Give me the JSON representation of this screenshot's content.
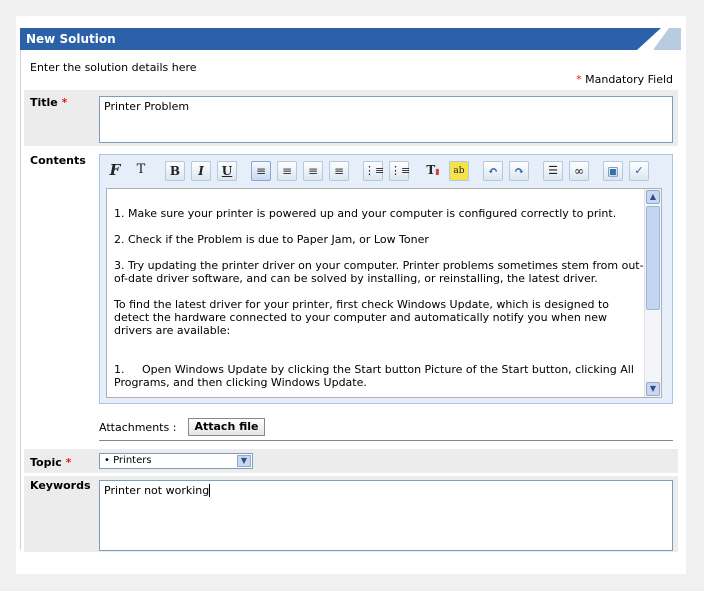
{
  "header": {
    "title": "New Solution"
  },
  "intro": "Enter the solution details here",
  "mandatory": {
    "star": "*",
    "text": "Mandatory Field"
  },
  "title_field": {
    "label": "Title",
    "star": "*",
    "value": "Printer Problem"
  },
  "contents": {
    "label": "Contents",
    "toolbar": [
      {
        "name": "font-family-icon",
        "glyph": "F"
      },
      {
        "name": "font-size-icon",
        "glyph": "T"
      },
      {
        "name": "bold-icon",
        "glyph": "B"
      },
      {
        "name": "italic-icon",
        "glyph": "I"
      },
      {
        "name": "underline-icon",
        "glyph": "U"
      },
      {
        "name": "align-left-icon",
        "glyph": "≡"
      },
      {
        "name": "align-center-icon",
        "glyph": "≡"
      },
      {
        "name": "align-right-icon",
        "glyph": "≡"
      },
      {
        "name": "justify-icon",
        "glyph": "≡"
      },
      {
        "name": "ordered-list-icon",
        "glyph": "⋮"
      },
      {
        "name": "unordered-list-icon",
        "glyph": "⋮"
      },
      {
        "name": "text-color-icon",
        "glyph": "T"
      },
      {
        "name": "highlight-icon",
        "glyph": "ab"
      },
      {
        "name": "undo-icon",
        "glyph": "↶"
      },
      {
        "name": "redo-icon",
        "glyph": "↷"
      },
      {
        "name": "horizontal-rule-icon",
        "glyph": "☰"
      },
      {
        "name": "link-icon",
        "glyph": "∞"
      },
      {
        "name": "insert-image-icon",
        "glyph": "▣"
      },
      {
        "name": "spellcheck-icon",
        "glyph": "✓"
      }
    ],
    "paragraphs": [
      "1. Make sure your printer is powered up and your computer is configured correctly to print.",
      "2. Check if the Problem is due to Paper Jam, or Low Toner",
      "3. Try updating the printer driver on your computer. Printer problems sometimes stem from out-of-date driver software, and can be solved by installing, or reinstalling, the latest driver.",
      "To find the latest driver for your printer, first check Windows Update, which is designed to detect the hardware connected to your computer and automatically notify you when new drivers are available:",
      "1.     Open Windows Update by clicking the Start button Picture of the Start button, clicking All Programs, and then clicking Windows Update."
    ]
  },
  "attachments": {
    "label": "Attachments :",
    "button": "Attach file"
  },
  "topic": {
    "label": "Topic",
    "star": "*",
    "value": "• Printers"
  },
  "keywords": {
    "label": "Keywords",
    "value": "Printer not working"
  }
}
